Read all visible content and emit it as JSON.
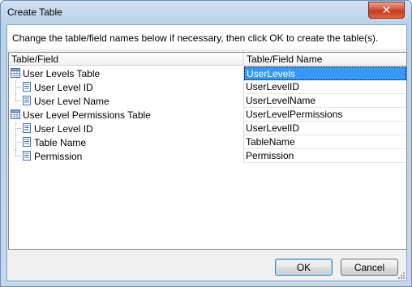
{
  "window": {
    "title": "Create Table",
    "close_label": "✕"
  },
  "instruction": "Change the table/field names below if necessary, then click OK to create the table(s).",
  "grid": {
    "columns": [
      "Table/Field",
      "Table/Field Name"
    ],
    "rows": [
      {
        "kind": "table",
        "label": "User Levels Table",
        "name": "UserLevels",
        "selected": true
      },
      {
        "kind": "field",
        "label": "User Level ID",
        "name": "UserLevelID"
      },
      {
        "kind": "field",
        "label": "User Level Name",
        "name": "UserLevelName"
      },
      {
        "kind": "table",
        "label": "User Level Permissions Table",
        "name": "UserLevelPermissions"
      },
      {
        "kind": "field",
        "label": "User Level ID",
        "name": "UserLevelID"
      },
      {
        "kind": "field",
        "label": "Table Name",
        "name": "TableName"
      },
      {
        "kind": "field",
        "label": "Permission",
        "name": "Permission"
      }
    ]
  },
  "buttons": {
    "ok": "OK",
    "cancel": "Cancel"
  },
  "icons": {
    "table": "table-icon",
    "field": "field-icon",
    "close": "close-icon",
    "grip": "resize-grip-icon"
  },
  "colors": {
    "selection": "#3399ff"
  }
}
